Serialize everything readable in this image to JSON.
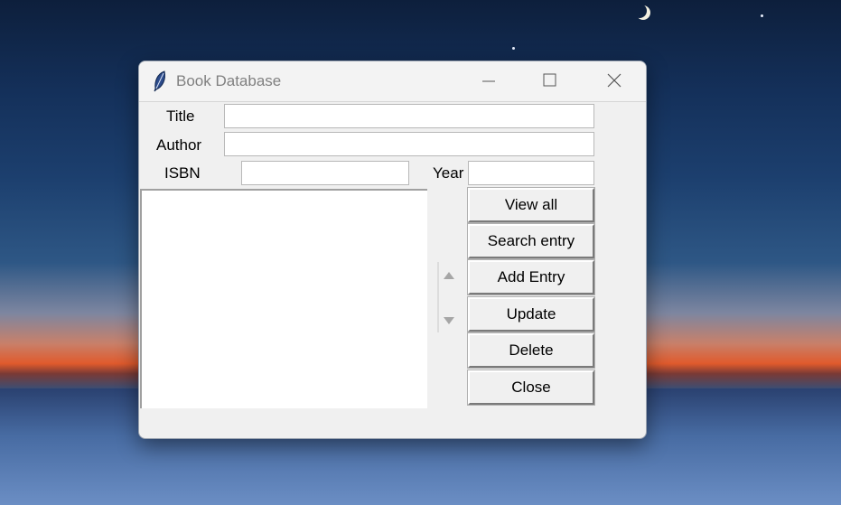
{
  "window": {
    "title": "Book Database",
    "icon": "feather-icon",
    "controls": [
      "minimize-icon",
      "maximize-icon",
      "close-icon"
    ]
  },
  "form": {
    "title_label": "Title",
    "author_label": "Author",
    "isbn_label": "ISBN",
    "year_label": "Year",
    "title_value": "",
    "author_value": "",
    "isbn_value": "",
    "year_value": ""
  },
  "buttons": {
    "view_all": "View all",
    "search_entry": "Search entry",
    "add_entry": "Add Entry",
    "update": "Update",
    "delete": "Delete",
    "close": "Close"
  },
  "listbox": {
    "items": []
  }
}
